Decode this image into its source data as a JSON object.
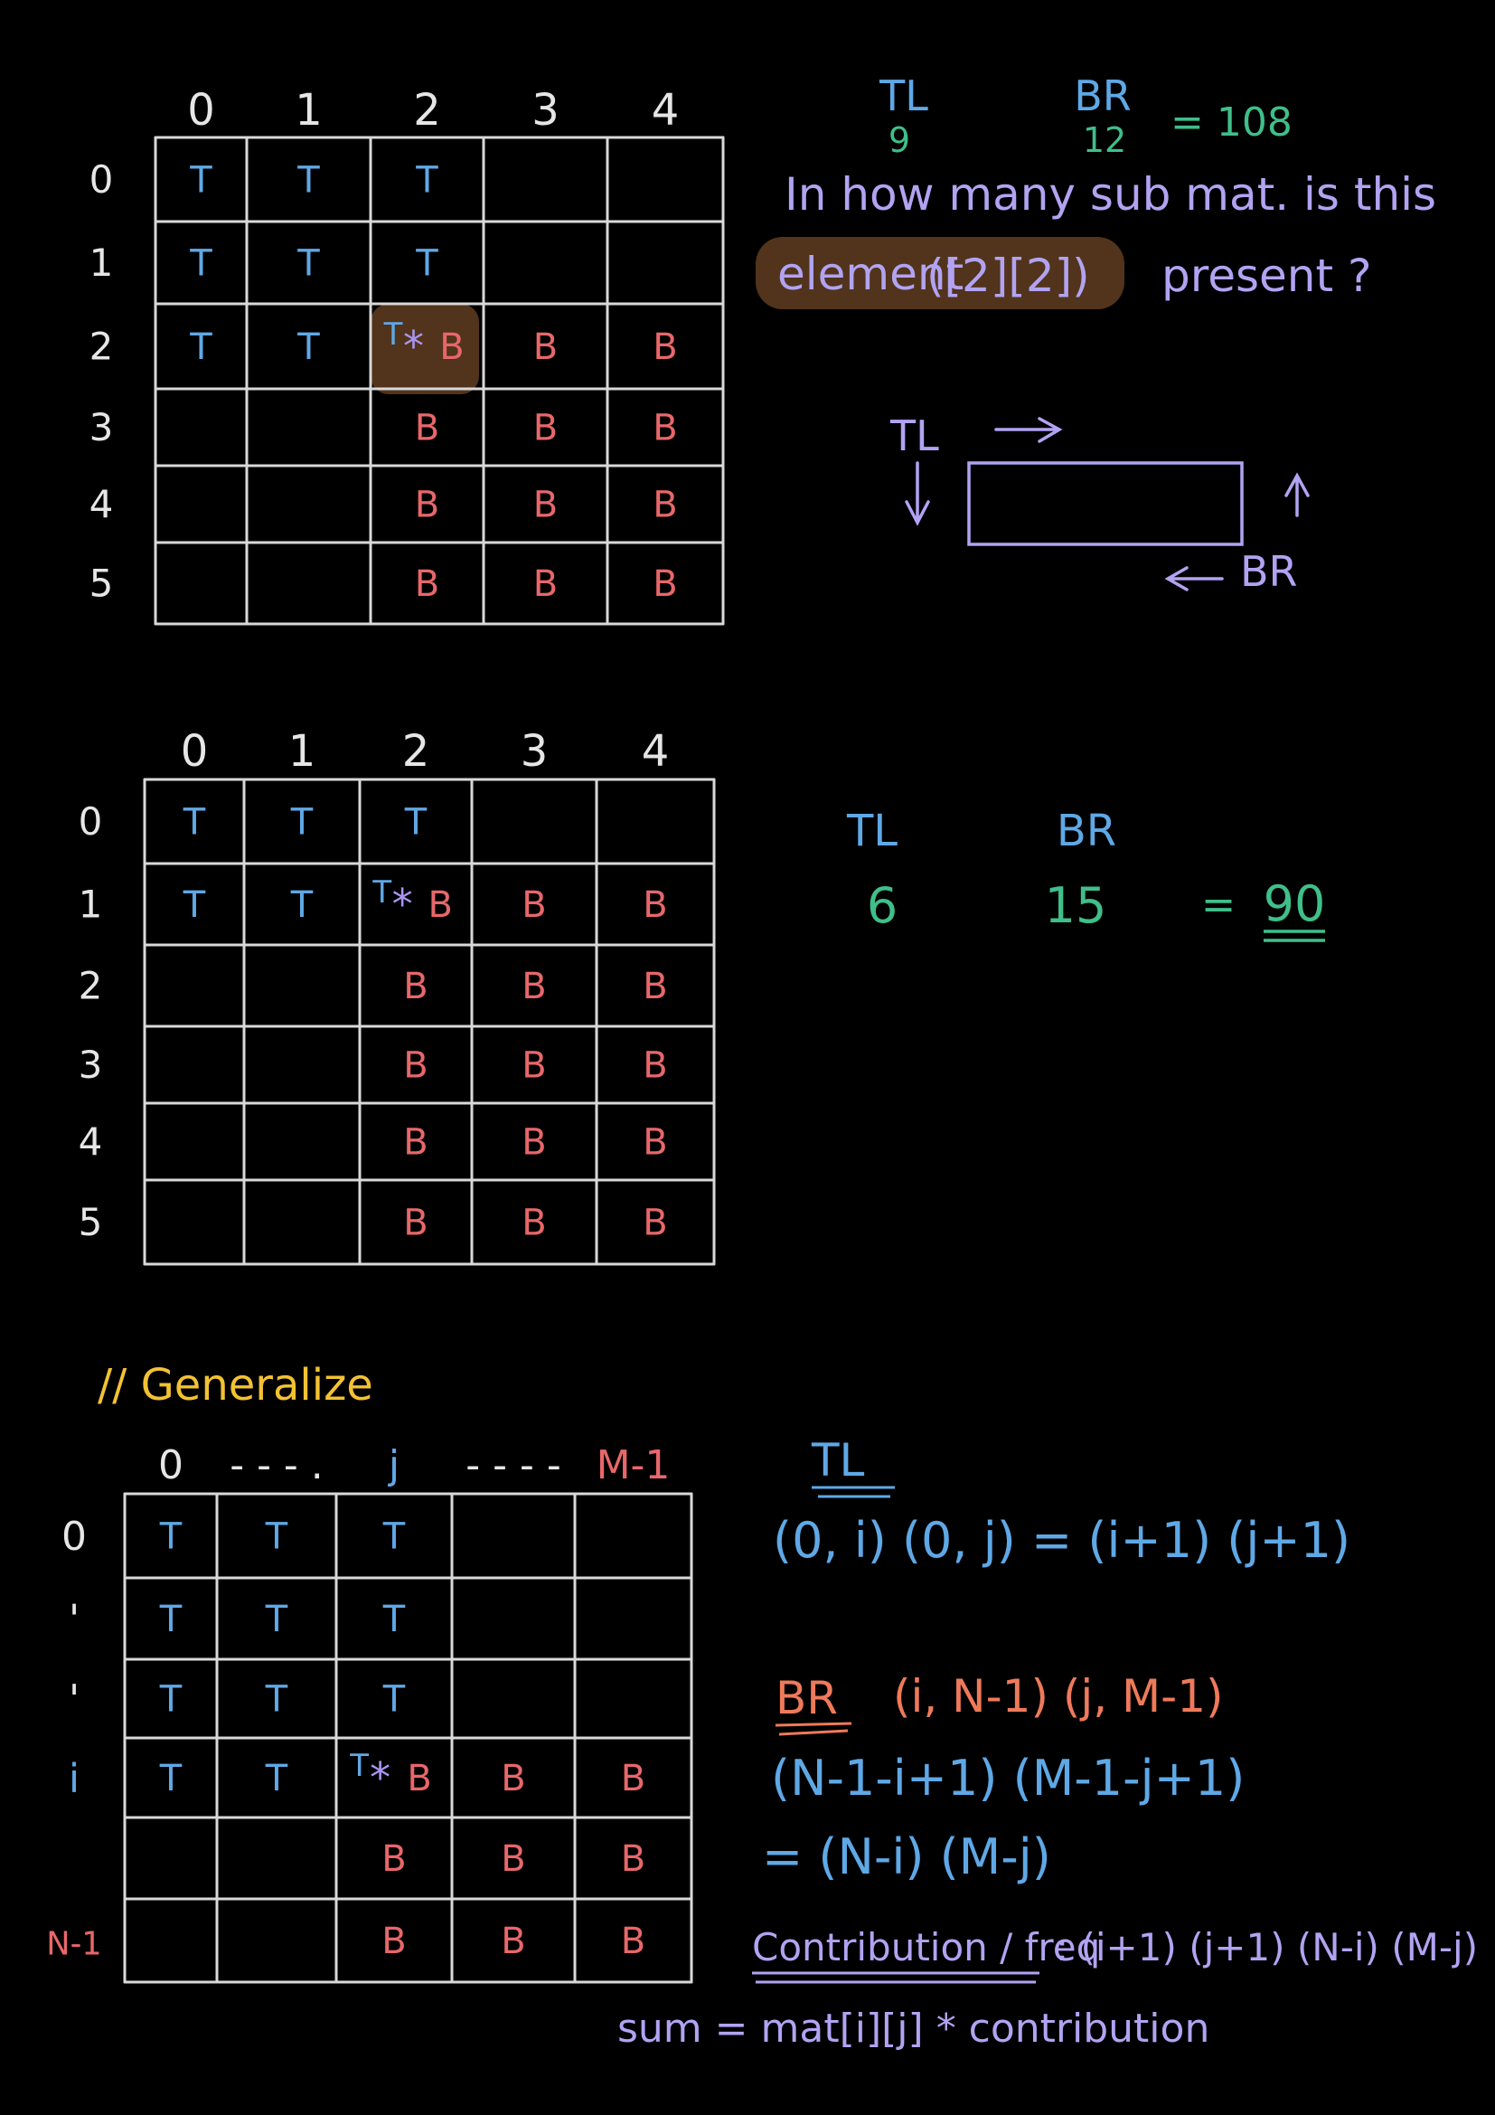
{
  "colors": {
    "background": "#000000",
    "grid": "#d9d9d9",
    "t_cell": "#5fa8e6",
    "b_cell": "#e8676a",
    "star": "#a995f0",
    "text_purple": "#b2a3f2",
    "text_blue": "#5fa8e6",
    "text_green": "#3fbf8a",
    "text_yellow": "#f2c233",
    "text_orange": "#ee7a5a",
    "text_red": "#e8676a",
    "highlight": "#5a3a1e"
  },
  "grid1": {
    "col_labels": [
      "0",
      "1",
      "2",
      "3",
      "4"
    ],
    "row_labels": [
      "0",
      "1",
      "2",
      "3",
      "4",
      "5"
    ],
    "cells": [
      [
        "T",
        "T",
        "T",
        "",
        ""
      ],
      [
        "T",
        "T",
        "T",
        "",
        ""
      ],
      [
        "T",
        "T",
        "TB",
        "B",
        "B"
      ],
      [
        "",
        "",
        "B",
        "B",
        "B"
      ],
      [
        "",
        "",
        "B",
        "B",
        "B"
      ],
      [
        "",
        "",
        "B",
        "B",
        "B"
      ]
    ],
    "star": "*",
    "highlight_cell": [
      2,
      2
    ]
  },
  "grid1_notes": {
    "tl_label": "TL",
    "tl_value": "9",
    "br_label": "BR",
    "br_value": "12",
    "result": "= 108",
    "question_line1": "In how many sub mat. is this",
    "question_line2_prefix": "element",
    "question_line2_index": "([2][2])",
    "question_line2_suffix": "present ?",
    "diagram_tl": "TL",
    "diagram_br": "BR"
  },
  "grid2": {
    "col_labels": [
      "0",
      "1",
      "2",
      "3",
      "4"
    ],
    "row_labels": [
      "0",
      "1",
      "2",
      "3",
      "4",
      "5"
    ],
    "cells": [
      [
        "T",
        "T",
        "T",
        "",
        ""
      ],
      [
        "T",
        "T",
        "TB",
        "B",
        "B"
      ],
      [
        "",
        "",
        "B",
        "B",
        "B"
      ],
      [
        "",
        "",
        "B",
        "B",
        "B"
      ],
      [
        "",
        "",
        "B",
        "B",
        "B"
      ],
      [
        "",
        "",
        "B",
        "B",
        "B"
      ]
    ],
    "star": "*"
  },
  "grid2_notes": {
    "tl_label": "TL",
    "br_label": "BR",
    "tl_value": "6",
    "br_value": "15",
    "equals": "=",
    "result": "90"
  },
  "generalize": {
    "heading": "// Generalize",
    "col_labels": [
      "0",
      "- - - .",
      "j",
      "- - - -",
      "M-1"
    ],
    "row_labels": [
      "0",
      "'",
      "'",
      "i",
      "",
      "N-1"
    ],
    "cells": [
      [
        "T",
        "T",
        "T",
        "",
        ""
      ],
      [
        "T",
        "T",
        "T",
        "",
        ""
      ],
      [
        "T",
        "T",
        "T",
        "",
        ""
      ],
      [
        "T",
        "T",
        "TB",
        "B",
        "B"
      ],
      [
        "",
        "",
        "B",
        "B",
        "B"
      ],
      [
        "",
        "",
        "B",
        "B",
        "B"
      ]
    ],
    "star": "*"
  },
  "formulas": {
    "tl_heading": "TL",
    "tl_formula": "(0, i) (0, j) = (i+1) (j+1)",
    "br_heading": "BR",
    "br_range": "(i, N-1) (j, M-1)",
    "br_expansion": "(N-1-i+1) (M-1-j+1)",
    "br_simplified": "= (N-i) (M-j)",
    "contribution_label": "Contribution / freq",
    "contribution_formula": ": (i+1) (j+1) (N-i) (M-j)",
    "sum_formula": "sum = mat[i][j] * contribution"
  }
}
